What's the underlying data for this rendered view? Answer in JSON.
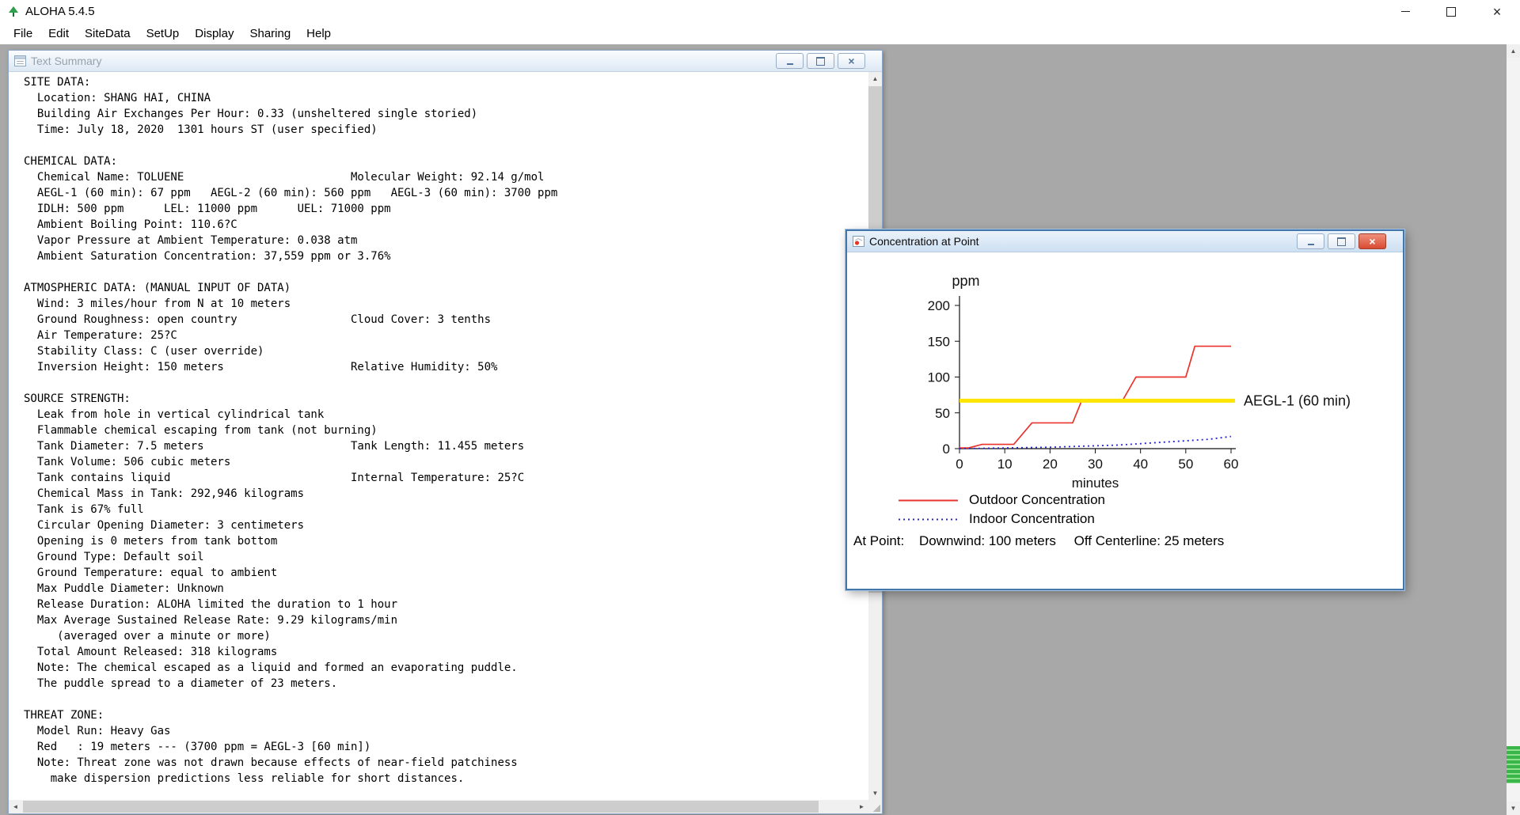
{
  "app": {
    "title": "ALOHA 5.4.5",
    "menu": [
      "File",
      "Edit",
      "SiteData",
      "SetUp",
      "Display",
      "Sharing",
      "Help"
    ]
  },
  "colors": {
    "mdi_background": "#a8a8a8",
    "threshold_yellow": "#ffe400",
    "outdoor_red": "#e8342c",
    "indoor_blue": "#2828c8",
    "close_button_red": "#d84a31",
    "scroll_thumb_green": "#39b54a"
  },
  "text_summary_window": {
    "title": "Text Summary",
    "lines": [
      "SITE DATA:",
      "  Location: SHANG HAI, CHINA",
      "  Building Air Exchanges Per Hour: 0.33 (unsheltered single storied)",
      "  Time: July 18, 2020  1301 hours ST (user specified)",
      "",
      "CHEMICAL DATA:",
      "  Chemical Name: TOLUENE                         Molecular Weight: 92.14 g/mol",
      "  AEGL-1 (60 min): 67 ppm   AEGL-2 (60 min): 560 ppm   AEGL-3 (60 min): 3700 ppm",
      "  IDLH: 500 ppm      LEL: 11000 ppm      UEL: 71000 ppm",
      "  Ambient Boiling Point: 110.6?C",
      "  Vapor Pressure at Ambient Temperature: 0.038 atm",
      "  Ambient Saturation Concentration: 37,559 ppm or 3.76%",
      "",
      "ATMOSPHERIC DATA: (MANUAL INPUT OF DATA)",
      "  Wind: 3 miles/hour from N at 10 meters",
      "  Ground Roughness: open country                 Cloud Cover: 3 tenths",
      "  Air Temperature: 25?C",
      "  Stability Class: C (user override)",
      "  Inversion Height: 150 meters                   Relative Humidity: 50%",
      "",
      "SOURCE STRENGTH:",
      "  Leak from hole in vertical cylindrical tank",
      "  Flammable chemical escaping from tank (not burning)",
      "  Tank Diameter: 7.5 meters                      Tank Length: 11.455 meters",
      "  Tank Volume: 506 cubic meters",
      "  Tank contains liquid                           Internal Temperature: 25?C",
      "  Chemical Mass in Tank: 292,946 kilograms",
      "  Tank is 67% full",
      "  Circular Opening Diameter: 3 centimeters",
      "  Opening is 0 meters from tank bottom",
      "  Ground Type: Default soil",
      "  Ground Temperature: equal to ambient",
      "  Max Puddle Diameter: Unknown",
      "  Release Duration: ALOHA limited the duration to 1 hour",
      "  Max Average Sustained Release Rate: 9.29 kilograms/min",
      "     (averaged over a minute or more)",
      "  Total Amount Released: 318 kilograms",
      "  Note: The chemical escaped as a liquid and formed an evaporating puddle.",
      "  The puddle spread to a diameter of 23 meters.",
      "",
      "THREAT ZONE:",
      "  Model Run: Heavy Gas",
      "  Red   : 19 meters --- (3700 ppm = AEGL-3 [60 min])",
      "  Note: Threat zone was not drawn because effects of near-field patchiness",
      "    make dispersion predictions less reliable for short distances."
    ]
  },
  "concentration_window": {
    "title": "Concentration at Point",
    "at_point_label": "At Point:",
    "downwind": "Downwind: 100 meters",
    "off_centerline": "Off Centerline: 25 meters"
  },
  "chart_data": {
    "type": "line",
    "title": "",
    "xlabel": "minutes",
    "ylabel": "ppm",
    "xlim": [
      0,
      60
    ],
    "ylim": [
      0,
      200
    ],
    "xticks": [
      0,
      10,
      20,
      30,
      40,
      50,
      60
    ],
    "yticks": [
      0,
      50,
      100,
      150,
      200
    ],
    "grid": false,
    "legend_position": "below",
    "threshold": {
      "label": "AEGL-1 (60 min)",
      "value": 67,
      "color": "#ffe400"
    },
    "series": [
      {
        "name": "Outdoor Concentration",
        "color": "#e8342c",
        "style": "solid",
        "points": [
          [
            0,
            1
          ],
          [
            2,
            1
          ],
          [
            5,
            6
          ],
          [
            12,
            6
          ],
          [
            16,
            36
          ],
          [
            25,
            36
          ],
          [
            27,
            67
          ],
          [
            36,
            67
          ],
          [
            39,
            100
          ],
          [
            50,
            100
          ],
          [
            52,
            143
          ],
          [
            60,
            143
          ]
        ]
      },
      {
        "name": "Indoor Concentration",
        "color": "#2828c8",
        "style": "dashed",
        "points": [
          [
            0,
            0
          ],
          [
            10,
            1
          ],
          [
            20,
            2
          ],
          [
            25,
            3
          ],
          [
            30,
            4
          ],
          [
            35,
            5
          ],
          [
            40,
            7
          ],
          [
            45,
            9
          ],
          [
            50,
            11
          ],
          [
            55,
            13
          ],
          [
            60,
            17
          ]
        ]
      }
    ]
  }
}
